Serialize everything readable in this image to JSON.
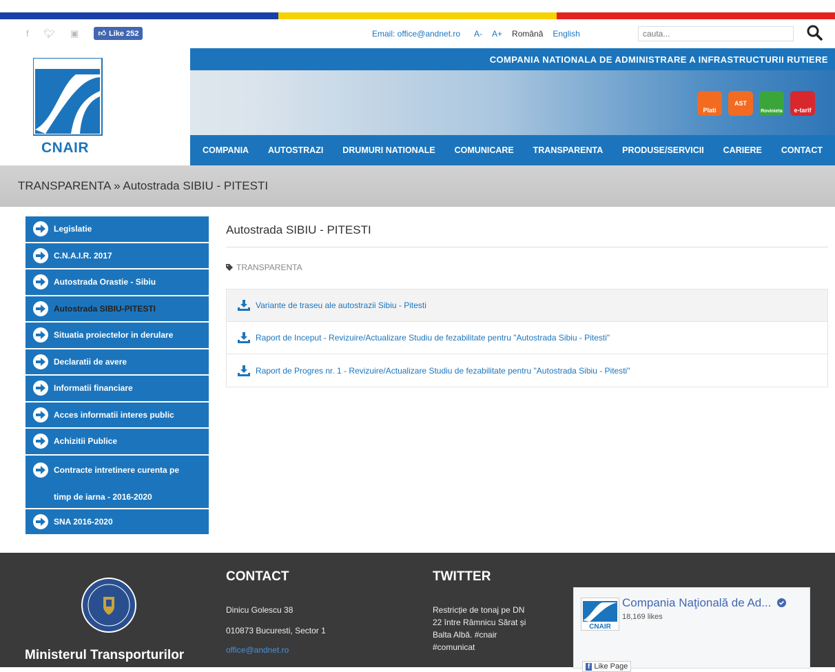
{
  "colors": {
    "blue": "#1c75bc",
    "flag_blue": "#1b3fa8",
    "flag_yellow": "#f6d200",
    "flag_red": "#e52222"
  },
  "topbar": {
    "fb_like": "Like 252",
    "email": "Email: office@andnet.ro",
    "font_decrease": "A-",
    "font_increase": "A+",
    "lang_ro": "Română",
    "lang_en": "English",
    "search_placeholder": "cauta..."
  },
  "header": {
    "company_full": "COMPANIA NATIONALA DE ADMINISTRARE A INFRASTRUCTURII RUTIERE",
    "logo_text": "CNAIR",
    "apps": [
      "Plati",
      "AST",
      "Rovinieta",
      "e-tarif"
    ]
  },
  "nav": [
    "COMPANIA",
    "AUTOSTRAZI",
    "DRUMURI NATIONALE",
    "COMUNICARE",
    "TRANSPARENTA",
    "PRODUSE/SERVICII",
    "CARIERE",
    "CONTACT"
  ],
  "breadcrumb": "TRANSPARENTA » Autostrada SIBIU - PITESTI",
  "sidebar": [
    "Legislatie",
    "C.N.A.I.R. 2017",
    "Autostrada Orastie - Sibiu",
    "Autostrada SIBIU-PITESTI",
    "Situatia proiectelor in derulare",
    "Declaratii de avere",
    "Informatii financiare",
    "Acces informatii interes public",
    "Achizitii Publice",
    "Contracte intretinere curenta pe",
    "timp de iarna - 2016-2020",
    "SNA 2016-2020"
  ],
  "main": {
    "title": "Autostrada SIBIU - PITESTI",
    "tag": "TRANSPARENTA",
    "files": [
      "Variante de traseu ale autostrazii Sibiu - Pitesti",
      "Raport de Inceput - Revizuire/Actualizare Studiu de fezabilitate pentru \"Autostrada Sibiu - Pitesti\"",
      "Raport de Progres nr. 1 - Revizuire/Actualizare Studiu de fezabilitate pentru \"Autostrada Sibiu - Pitesti\""
    ]
  },
  "footer": {
    "ministry": "Ministerul Transporturilor",
    "contact_title": "CONTACT",
    "address1": "Dinicu Golescu 38",
    "address2": "010873 Bucuresti, Sector 1",
    "email": "office@andnet.ro",
    "twitter_title": "TWITTER",
    "tweet": [
      "Restricție de tonaj pe DN",
      "22 între Râmnicu Sărat și",
      "Balta Albă. #cnair",
      "#comunicat"
    ],
    "fb_page": "Compania Naţională de Ad...",
    "fb_likes": "18,169 likes",
    "fb_like_page": "Like Page"
  }
}
